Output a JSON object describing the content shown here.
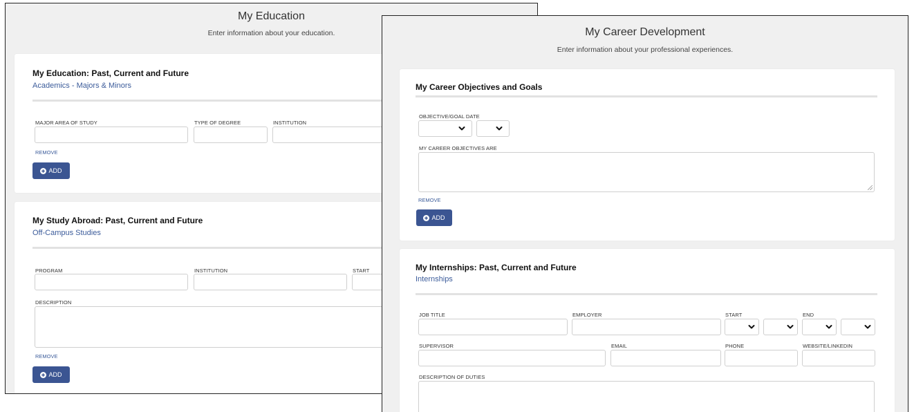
{
  "education": {
    "title": "My Education",
    "subtitle": "Enter information about your education.",
    "degree_section": {
      "title": "My Education: Past, Current and Future",
      "link": "Academics - Majors & Minors",
      "labels": {
        "major": "MAJOR AREA OF STUDY",
        "degree": "TYPE OF DEGREE",
        "institution": "INSTITUTION"
      },
      "remove": "REMOVE",
      "add": "ADD"
    },
    "abroad_section": {
      "title": "My Study Abroad: Past, Current and Future",
      "link": "Off-Campus Studies",
      "labels": {
        "program": "PROGRAM",
        "institution": "INSTITUTION",
        "start": "START",
        "description": "DESCRIPTION"
      },
      "remove": "REMOVE",
      "add": "ADD"
    }
  },
  "career": {
    "title": "My Career Development",
    "subtitle": "Enter information about your professional experiences.",
    "objectives_section": {
      "title": "My Career Objectives and Goals",
      "labels": {
        "goal_date": "OBJECTIVE/GOAL DATE",
        "objectives": "MY CAREER OBJECTIVES ARE"
      },
      "remove": "REMOVE",
      "add": "ADD"
    },
    "internships_section": {
      "title": "My Internships: Past, Current and Future",
      "link": "Internships",
      "labels": {
        "job_title": "JOB TITLE",
        "employer": "EMPLOYER",
        "start": "START",
        "end": "END",
        "supervisor": "SUPERVISOR",
        "email": "EMAIL",
        "phone": "PHONE",
        "website": "WEBSITE/LINKEDIN",
        "duties": "DESCRIPTION OF DUTIES"
      }
    }
  },
  "icons": {
    "select": "chevron-down-icon",
    "add": "plus-circle-icon",
    "resize": "resize-grip-icon"
  },
  "colors": {
    "link": "#3b5b9a",
    "button": "#3b5592",
    "background": "#f0f0f0"
  }
}
